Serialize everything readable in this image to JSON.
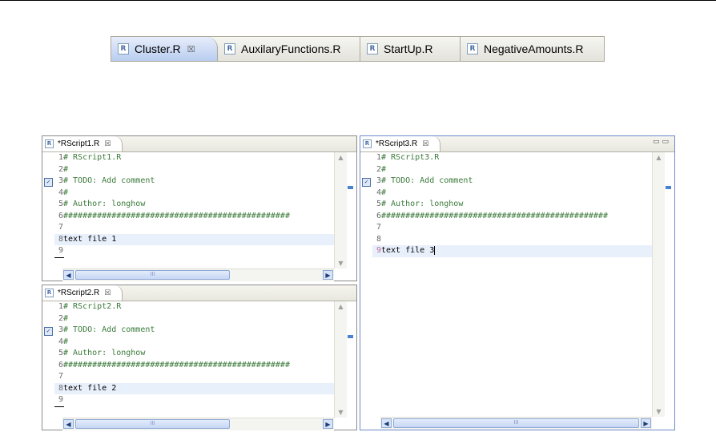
{
  "top_tabs": [
    {
      "label": "Cluster.R",
      "icon": "r-file-icon",
      "active": true,
      "closable": true
    },
    {
      "label": "AuxilaryFunctions.R",
      "icon": "r-file-icon",
      "active": false
    },
    {
      "label": "StartUp.R",
      "icon": "r-file-icon",
      "active": false
    },
    {
      "label": "NegativeAmounts.R",
      "icon": "r-file-icon",
      "active": false
    }
  ],
  "r_glyph": "R",
  "close_glyph": "☒",
  "editors": {
    "script1": {
      "tab_label": "*RScript1.R",
      "lines": [
        {
          "n": "1",
          "text": "# RScript1.R"
        },
        {
          "n": "2",
          "text": "#"
        },
        {
          "n": "3",
          "text": "# TODO: Add comment"
        },
        {
          "n": "4",
          "text": "#"
        },
        {
          "n": "5",
          "text": "# Author: longhow"
        },
        {
          "n": "6",
          "text": "###############################################"
        },
        {
          "n": "7",
          "text": ""
        },
        {
          "n": "8",
          "text": "text file 1"
        },
        {
          "n": "9",
          "text": ""
        }
      ]
    },
    "script2": {
      "tab_label": "*RScript2.R",
      "lines": [
        {
          "n": "1",
          "text": "# RScript2.R"
        },
        {
          "n": "2",
          "text": "#"
        },
        {
          "n": "3",
          "text": "# TODO: Add comment"
        },
        {
          "n": "4",
          "text": "#"
        },
        {
          "n": "5",
          "text": "# Author: longhow"
        },
        {
          "n": "6",
          "text": "###############################################"
        },
        {
          "n": "7",
          "text": ""
        },
        {
          "n": "8",
          "text": "text file 2"
        },
        {
          "n": "9",
          "text": ""
        }
      ]
    },
    "script3": {
      "tab_label": "*RScript3.R",
      "lines": [
        {
          "n": "1",
          "text": "# RScript3.R"
        },
        {
          "n": "2",
          "text": "#"
        },
        {
          "n": "3",
          "text": "# TODO: Add comment"
        },
        {
          "n": "4",
          "text": "#"
        },
        {
          "n": "5",
          "text": "# Author: longhow"
        },
        {
          "n": "6",
          "text": "###############################################"
        },
        {
          "n": "7",
          "text": ""
        },
        {
          "n": "8",
          "text": ""
        },
        {
          "n": "9",
          "text": "text file 3"
        }
      ]
    }
  },
  "task_marker_glyph": "✓",
  "scroll": {
    "up": "▲",
    "down": "▼",
    "left": "◀",
    "right": "▶",
    "grip": "III"
  },
  "window_controls": "▭▭",
  "colors": {
    "accent": "#4b82d0",
    "current_line": "#e8f0fc",
    "comment": "#3a7a3a"
  }
}
